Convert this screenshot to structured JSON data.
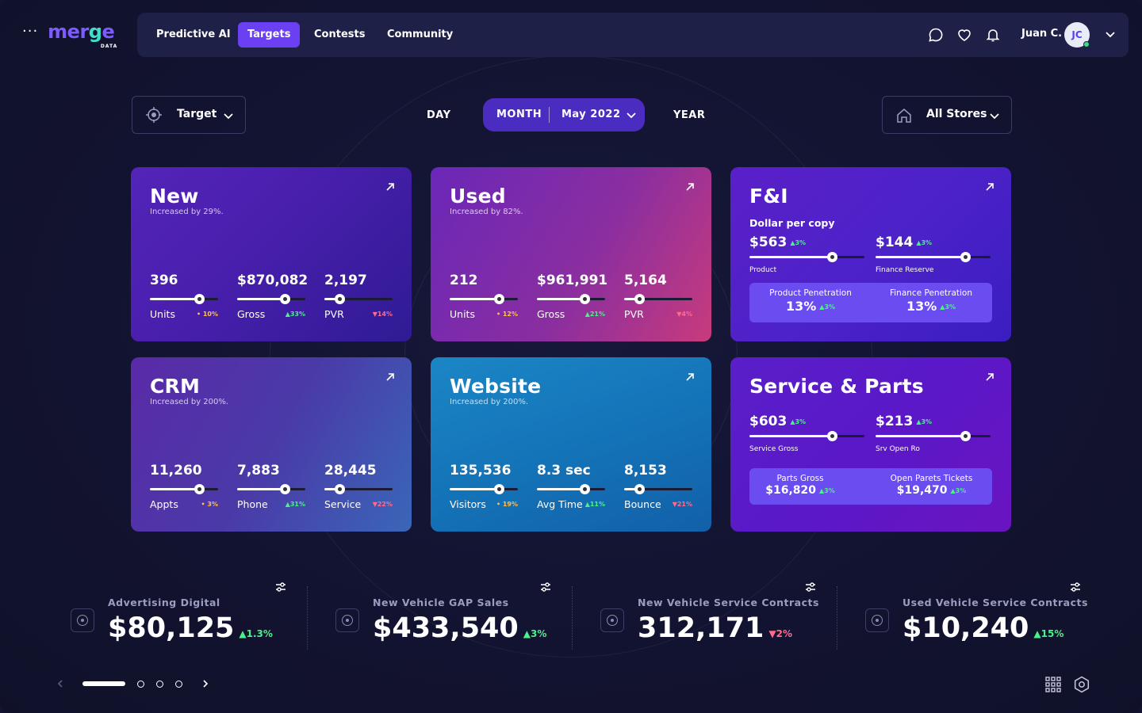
{
  "brand": {
    "name_a": "mer",
    "name_g": "g",
    "name_b": "e",
    "sub": "DATA",
    "menu_dots": "···"
  },
  "nav": {
    "items": [
      "Predictive AI",
      "Targets",
      "Contests",
      "Community"
    ],
    "active": "Targets",
    "user_name": "Juan C.",
    "user_initials": "JC"
  },
  "controls": {
    "target_label": "Target",
    "period_day": "DAY",
    "period_month": "MONTH",
    "month_value": "May 2022",
    "period_year": "YEAR",
    "stores_label": "All Stores"
  },
  "cards": {
    "new": {
      "title": "New",
      "subtitle": "Increased by 29%.",
      "metrics": [
        {
          "value": "396",
          "label": "Units",
          "change": "• 10%",
          "trend": "neu",
          "progress": 0.72
        },
        {
          "value": "$870,082",
          "label": "Gross",
          "change": "▲33%",
          "trend": "up",
          "progress": 0.7
        },
        {
          "value": "2,197",
          "label": "PVR",
          "change": "▼14%",
          "trend": "down",
          "progress": 0.22
        }
      ]
    },
    "used": {
      "title": "Used",
      "subtitle": "Increased by 82%.",
      "metrics": [
        {
          "value": "212",
          "label": "Units",
          "change": "• 12%",
          "trend": "neu",
          "progress": 0.72
        },
        {
          "value": "$961,991",
          "label": "Gross",
          "change": "▲21%",
          "trend": "up",
          "progress": 0.7
        },
        {
          "value": "5,164",
          "label": "PVR",
          "change": "▼4%",
          "trend": "down",
          "progress": 0.22
        }
      ]
    },
    "fi": {
      "title": "F&I",
      "section": "Dollar per copy",
      "metrics": [
        {
          "value": "$563",
          "change": "▲3%",
          "label": "Product",
          "progress": 0.72
        },
        {
          "value": "$144",
          "change": "▲3%",
          "label": "Finance Reserve",
          "progress": 0.78
        }
      ],
      "box": [
        {
          "title": "Product Penetration",
          "value": "13%",
          "change": "▲3%"
        },
        {
          "title": "Finance Penetration",
          "value": "13%",
          "change": "▲3%"
        }
      ]
    },
    "crm": {
      "title": "CRM",
      "subtitle": "Increased by 200%.",
      "metrics": [
        {
          "value": "11,260",
          "label": "Appts",
          "change": "• 3%",
          "trend": "neu",
          "progress": 0.72
        },
        {
          "value": "7,883",
          "label": "Phone",
          "change": "▲31%",
          "trend": "up",
          "progress": 0.7
        },
        {
          "value": "28,445",
          "label": "Service",
          "change": "▼22%",
          "trend": "down",
          "progress": 0.22
        }
      ]
    },
    "website": {
      "title": "Website",
      "subtitle": "Increased by 200%.",
      "metrics": [
        {
          "value": "135,536",
          "label": "Visitors",
          "change": "• 19%",
          "trend": "neu",
          "progress": 0.72
        },
        {
          "value": "8.3 sec",
          "label": "Avg Time",
          "change": "▲11%",
          "trend": "up",
          "progress": 0.7
        },
        {
          "value": "8,153",
          "label": "Bounce",
          "change": "▼21%",
          "trend": "down",
          "progress": 0.22
        }
      ]
    },
    "service": {
      "title": "Service & Parts",
      "metrics": [
        {
          "value": "$603",
          "change": "▲3%",
          "label": "Service Gross",
          "progress": 0.72
        },
        {
          "value": "$213",
          "change": "▲3%",
          "label": "Srv Open Ro",
          "progress": 0.78
        }
      ],
      "box": [
        {
          "title": "Parts Gross",
          "value": "$16,820",
          "change": "▲3%"
        },
        {
          "title": "Open Parets Tickets",
          "value": "$19,470",
          "change": "▲3%"
        }
      ]
    }
  },
  "kpis": [
    {
      "name": "Advertising Digital",
      "value": "$80,125",
      "change": "▲1.3%",
      "trend": "up"
    },
    {
      "name": "New Vehicle GAP Sales",
      "value": "$433,540",
      "change": "▲3%",
      "trend": "up"
    },
    {
      "name": "New Vehicle Service Contracts",
      "value": "312,171",
      "change": "▼2%",
      "trend": "down"
    },
    {
      "name": "Used Vehicle Service Contracts",
      "value": "$10,240",
      "change": "▲15%",
      "trend": "up"
    }
  ],
  "pager": {
    "pages": 4,
    "active": 1
  },
  "colors": {
    "bg": "#131432",
    "nav": "#1f2048",
    "accent": "#6b3ff2",
    "up": "#4cf08a",
    "down": "#ff6b8e",
    "neutral": "#ffc04d"
  },
  "icons": [
    "menu-dots-icon",
    "chat-icon",
    "heart-icon",
    "bell-icon",
    "chevron-down-icon",
    "target-icon",
    "home-icon",
    "arrow-up-right-icon",
    "tune-icon",
    "chevron-left-icon",
    "chevron-right-icon",
    "grid-icon",
    "hexagon-icon"
  ]
}
